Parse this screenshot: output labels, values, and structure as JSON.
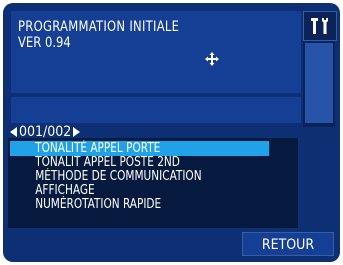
{
  "header": {
    "title": "PROGRAMMATION INITIALE",
    "version": "VER 0.94"
  },
  "icons": {
    "move": "move-arrows-icon",
    "tools": "tools-icon"
  },
  "pager": {
    "label": "001/002"
  },
  "menu": {
    "items": [
      {
        "label": "TONALITÉ APPEL PORTE",
        "selected": true
      },
      {
        "label": "TONALIT APPEL POSTE 2ND",
        "selected": false
      },
      {
        "label": "MÉTHODE DE COMMUNICATION",
        "selected": false
      },
      {
        "label": "AFFICHAGE",
        "selected": false
      },
      {
        "label": "NUMÉROTATION RAPIDE",
        "selected": false
      }
    ]
  },
  "footer": {
    "back_label": "RETOUR"
  },
  "colors": {
    "screen_bg": "#0d2f73",
    "panel_bg": "#153f94",
    "list_bg": "#061a40",
    "selected_bg": "#1fa2e8",
    "text": "#ffffff"
  }
}
